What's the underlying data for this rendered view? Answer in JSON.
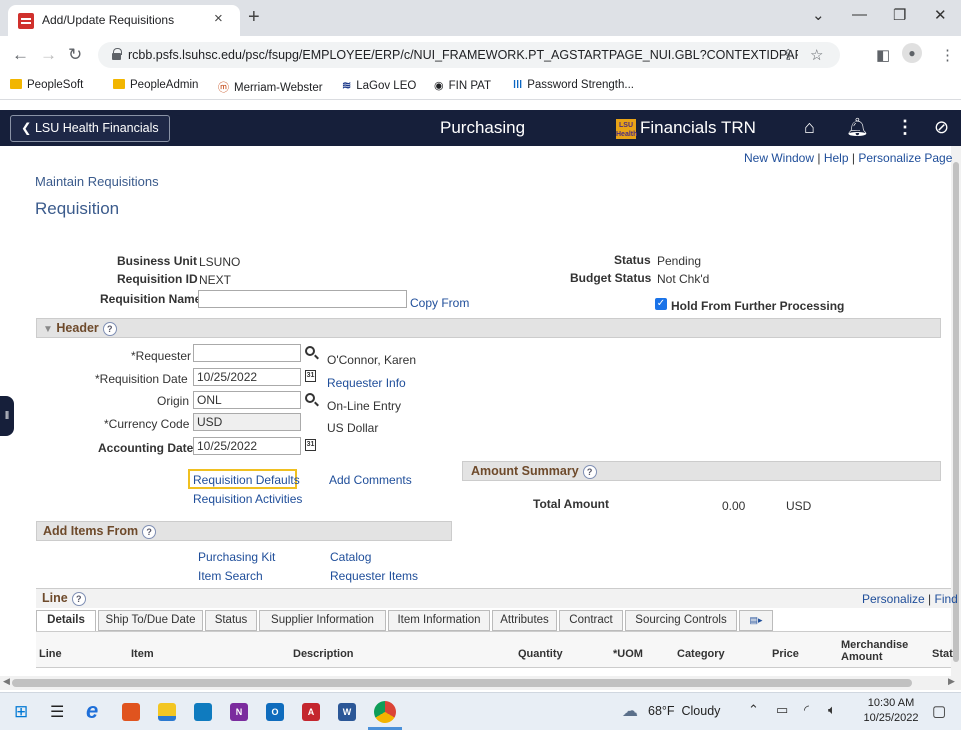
{
  "browser": {
    "tab_title": "Add/Update Requisitions",
    "tab_close": "×",
    "new_tab": "+",
    "url": "rcbb.psfs.lsuhsc.edu/psc/fsupg/EMPLOYEE/ERP/c/NUI_FRAMEWORK.PT_AGSTARTPAGE_NUI.GBL?CONTEXTIDPAR...",
    "bookmarks": [
      "PeopleSoft",
      "PeopleAdmin",
      "Merriam-Webster",
      "LaGov LEO",
      "FIN PAT",
      "Password Strength..."
    ]
  },
  "banner": {
    "home_label": "LSU Health Financials",
    "title": "Purchasing",
    "brand": "Financials TRN",
    "brand_logo": "LSU Health"
  },
  "topnav": {
    "new_window": "New Window",
    "help": "Help",
    "personalize": "Personalize Page",
    "sep": "|"
  },
  "page": {
    "breadcrumb": "Maintain Requisitions",
    "title": "Requisition"
  },
  "form": {
    "business_unit_label": "Business Unit",
    "business_unit": "LSUNO",
    "requisition_id_label": "Requisition ID",
    "requisition_id": "NEXT",
    "requisition_name_label": "Requisition Name",
    "requisition_name": "",
    "copy_from": "Copy From",
    "status_label": "Status",
    "status": "Pending",
    "budget_status_label": "Budget Status",
    "budget_status": "Not Chk'd",
    "hold_label": "Hold From Further Processing",
    "hold_checked": true
  },
  "header": {
    "section_title": "Header",
    "requester_label": "*Requester",
    "requester_value": "",
    "requester_name": "O'Connor, Karen",
    "req_date_label": "*Requisition Date",
    "req_date": "10/25/2022",
    "requester_info": "Requester Info",
    "origin_label": "Origin",
    "origin": "ONL",
    "origin_desc": "On-Line Entry",
    "currency_label": "*Currency Code",
    "currency": "USD",
    "currency_desc": "US Dollar",
    "acct_date_label": "Accounting Date",
    "acct_date": "10/25/2022",
    "req_defaults": "Requisition Defaults",
    "req_activities": "Requisition Activities",
    "add_comments": "Add Comments"
  },
  "amount_summary": {
    "title": "Amount Summary",
    "total_label": "Total Amount",
    "total": "0.00",
    "currency": "USD"
  },
  "add_items": {
    "title": "Add Items From",
    "purchasing_kit": "Purchasing Kit",
    "catalog": "Catalog",
    "item_search": "Item Search",
    "requester_items": "Requester Items"
  },
  "line": {
    "title": "Line",
    "personalize": "Personalize",
    "find": "Find",
    "sep": "|",
    "tabs": [
      "Details",
      "Ship To/Due Date",
      "Status",
      "Supplier Information",
      "Item Information",
      "Attributes",
      "Contract",
      "Sourcing Controls"
    ],
    "columns": [
      "Line",
      "Item",
      "Description",
      "Quantity",
      "*UOM",
      "Category",
      "Price",
      "Merchandise Amount",
      "Stat"
    ]
  },
  "taskbar": {
    "weather": "68°F  Cloudy",
    "time": "10:30 AM",
    "date": "10/25/2022"
  }
}
